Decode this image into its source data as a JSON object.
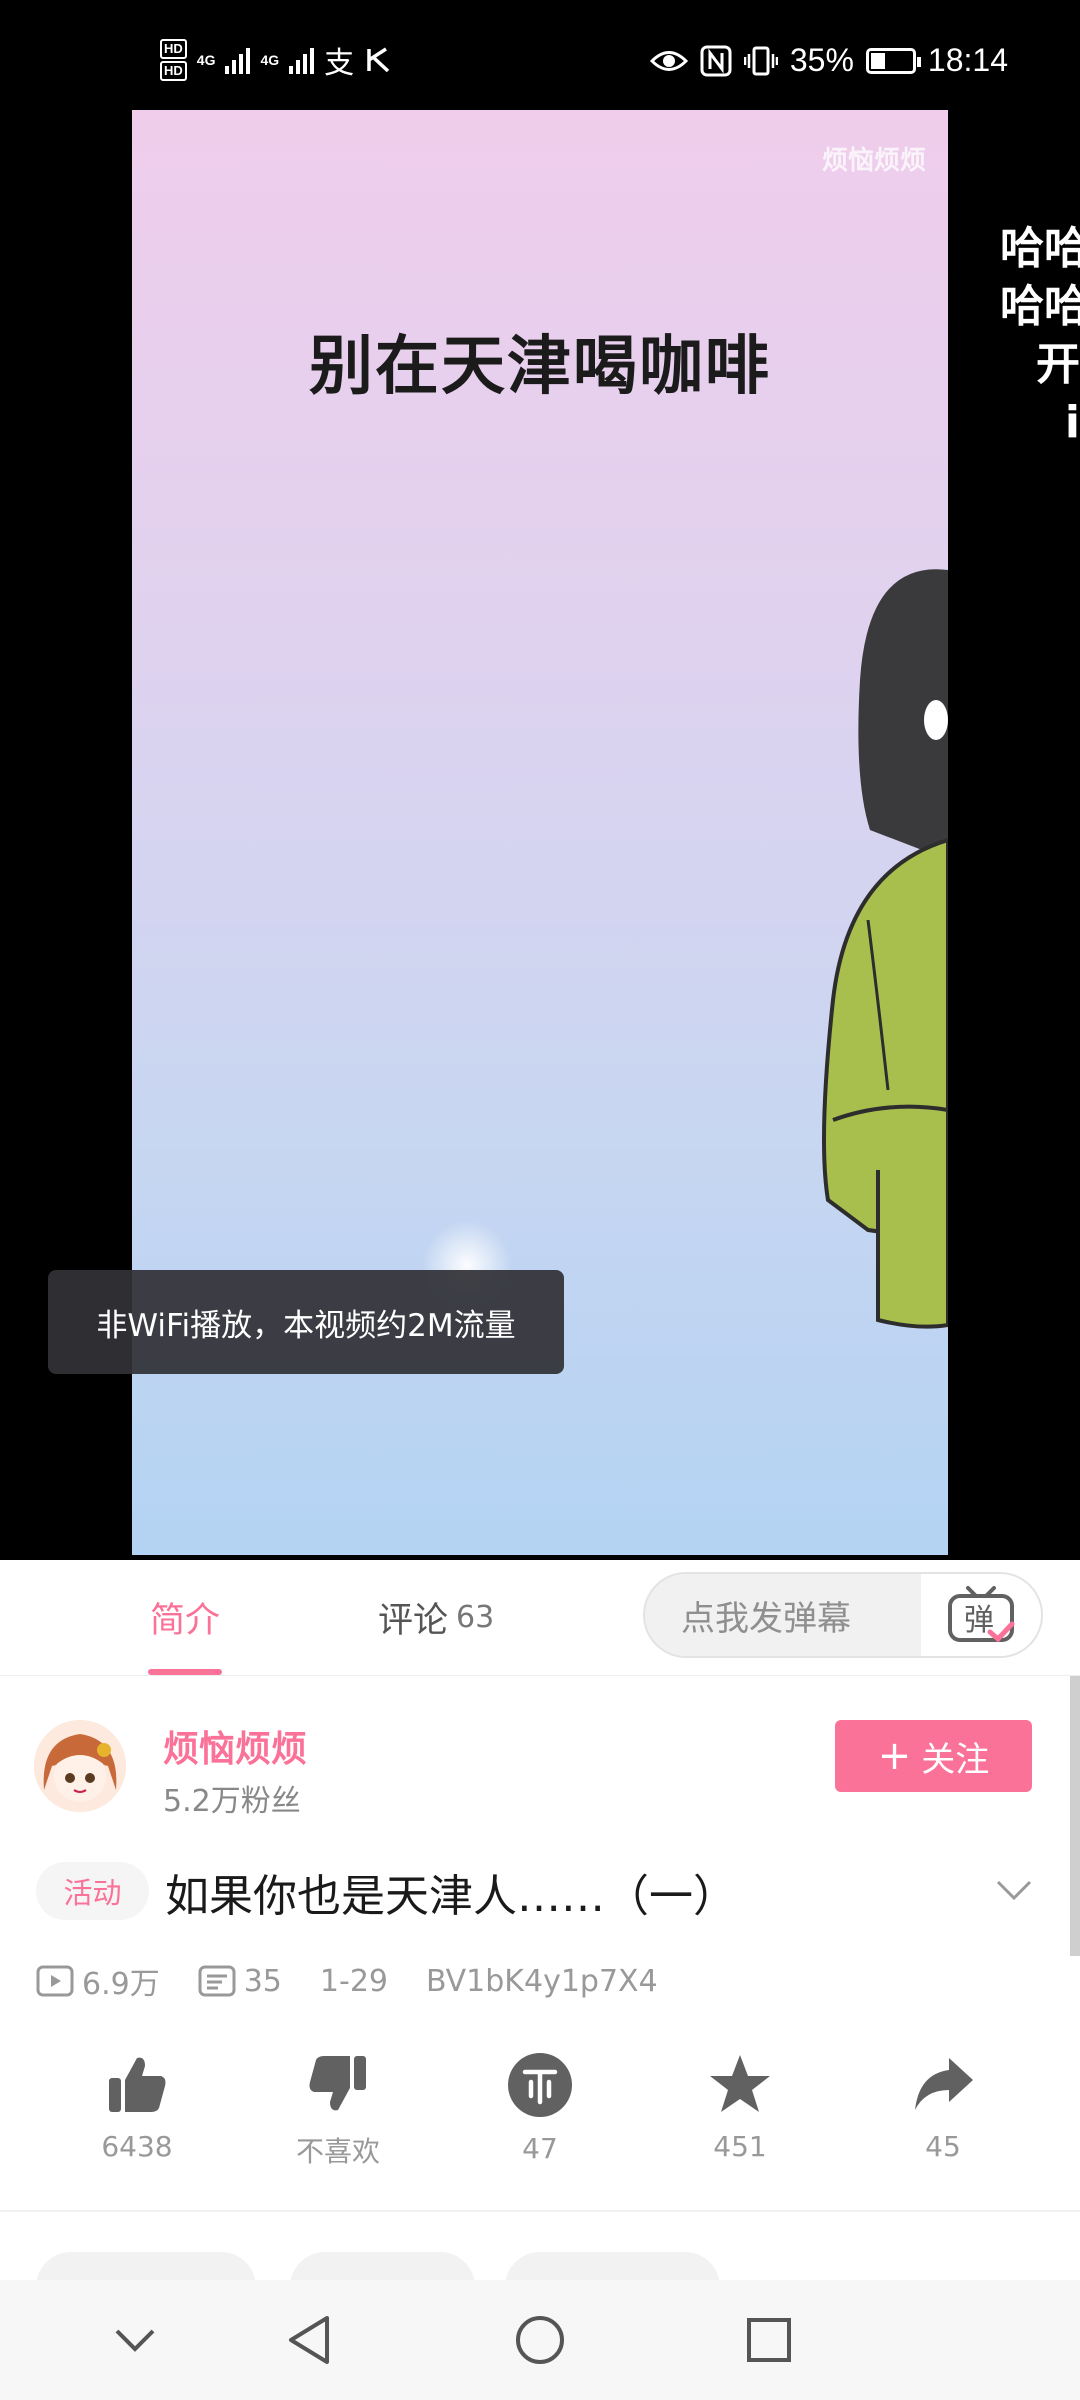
{
  "status_bar": {
    "hd1": "HD",
    "hd2": "HD",
    "net1": "4G",
    "net2": "4G",
    "battery_percent": "35%",
    "battery_level": 0.35,
    "time": "18:14",
    "icons": [
      "eye-icon",
      "nfc-icon",
      "vibrate-icon",
      "battery-icon",
      "alipay-icon",
      "notification-icon"
    ]
  },
  "video": {
    "watermark": "烦恼烦烦",
    "caption": "别在天津喝咖啡",
    "toast": "非WiFi播放，本视频约2M流量",
    "danmaku_lines": [
      "哈哈",
      "哈哈",
      "开",
      "i"
    ]
  },
  "tabs": {
    "intro": "简介",
    "comments": "评论",
    "comments_count": "63"
  },
  "danmaku_input": {
    "placeholder": "点我发弹幕",
    "button_glyph": "弹"
  },
  "uploader": {
    "name": "烦恼烦烦",
    "fans": "5.2万粉丝",
    "follow_label": "关注"
  },
  "video_info": {
    "tag": "活动",
    "title": "如果你也是天津人……（一）",
    "views": "6.9万",
    "danmaku_count": "35",
    "date": "1-29",
    "bvid": "BV1bK4y1p7X4"
  },
  "actions": {
    "like": "6438",
    "dislike": "不喜欢",
    "coin": "47",
    "favorite": "451",
    "share": "45"
  },
  "colors": {
    "accent": "#fb7299",
    "text_secondary": "#999999",
    "icon_gray": "#616161"
  }
}
